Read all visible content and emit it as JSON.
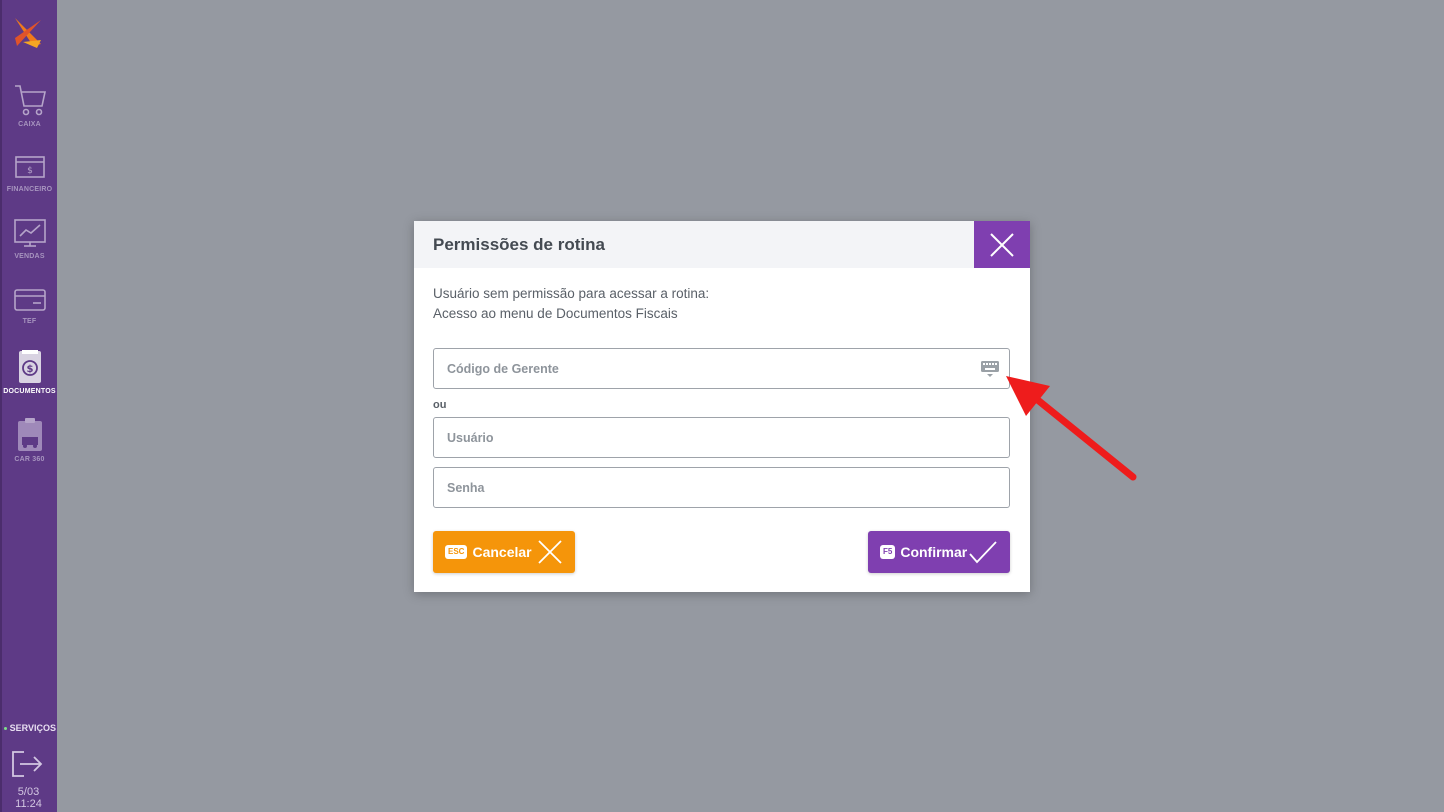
{
  "sidebar": {
    "items": [
      {
        "label": "CAIXA",
        "icon": "cart-icon"
      },
      {
        "label": "FINANCEIRO",
        "icon": "money-drawer-icon"
      },
      {
        "label": "VENDAS",
        "icon": "sales-chart-icon"
      },
      {
        "label": "TEF",
        "icon": "card-icon"
      },
      {
        "label": "DOCUMENTOS",
        "icon": "document-dollar-icon",
        "active": true
      },
      {
        "label": "CAR 360",
        "icon": "clipboard-car-icon"
      }
    ],
    "servicos_label": "SERVIÇOS",
    "date": "5/03",
    "time": "11:24"
  },
  "modal": {
    "title": "Permissões de rotina",
    "message_line1": "Usuário sem permissão para acessar a rotina:",
    "message_line2": "Acesso ao menu de Documentos Fiscais",
    "manager_code_placeholder": "Código de Gerente",
    "or_label": "ou",
    "user_placeholder": "Usuário",
    "password_placeholder": "Senha",
    "cancel": {
      "key": "ESC",
      "label": "Cancelar"
    },
    "confirm": {
      "key": "F5",
      "label": "Confirmar"
    }
  },
  "colors": {
    "sidebar": "#5e3a86",
    "accent_purple": "#7f3fb0",
    "cancel_orange": "#f5950a",
    "overlay": "#9599a1",
    "annotation_arrow": "#ee1c1c"
  }
}
